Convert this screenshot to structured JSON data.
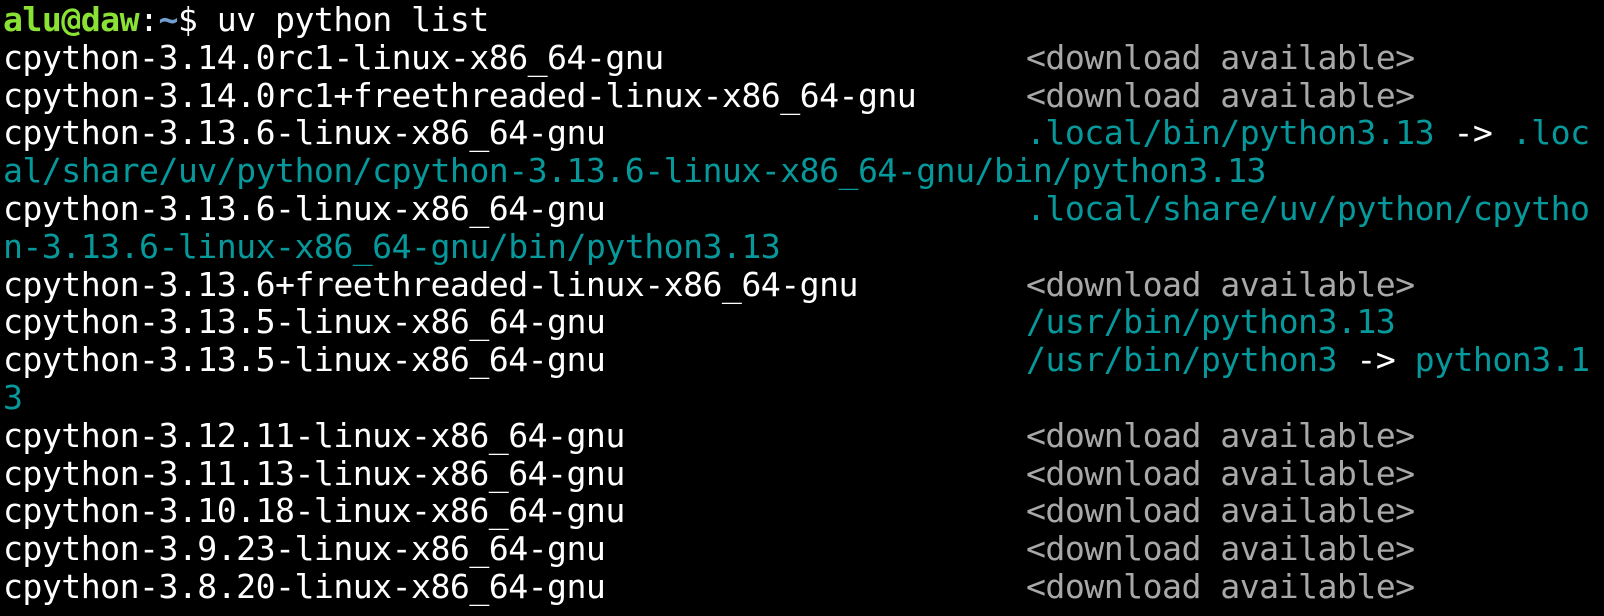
{
  "prompt": {
    "user_host": "alu@daw",
    "separator": ":",
    "path": "~",
    "dollar": "$ ",
    "command": "uv python list"
  },
  "colors": {
    "background": "#000000",
    "text": "#ffffff",
    "prompt_user": "#8ae234",
    "prompt_path": "#729fcf",
    "path_link": "#06989a",
    "download_available": "#a8a8a8"
  },
  "rows": [
    {
      "version": "cpython-3.14.0rc1-linux-x86_64-gnu",
      "status": "<download available>"
    },
    {
      "version": "cpython-3.14.0rc1+freethreaded-linux-x86_64-gnu",
      "status": "<download available>"
    },
    {
      "version": "cpython-3.13.6-linux-x86_64-gnu",
      "path": ".local/bin/python3.13",
      "arrow": " -> ",
      "target": ".loc",
      "wrap": "al/share/uv/python/cpython-3.13.6-linux-x86_64-gnu/bin/python3.13"
    },
    {
      "version": "cpython-3.13.6-linux-x86_64-gnu",
      "path": ".local/share/uv/python/cpytho",
      "wrap": "n-3.13.6-linux-x86_64-gnu/bin/python3.13"
    },
    {
      "version": "cpython-3.13.6+freethreaded-linux-x86_64-gnu",
      "status": "<download available>"
    },
    {
      "version": "cpython-3.13.5-linux-x86_64-gnu",
      "path": "/usr/bin/python3.13"
    },
    {
      "version": "cpython-3.13.5-linux-x86_64-gnu",
      "path": "/usr/bin/python3",
      "arrow": " -> ",
      "target": "python3.1",
      "wrap": "3"
    },
    {
      "version": "cpython-3.12.11-linux-x86_64-gnu",
      "status": "<download available>"
    },
    {
      "version": "cpython-3.11.13-linux-x86_64-gnu",
      "status": "<download available>"
    },
    {
      "version": "cpython-3.10.18-linux-x86_64-gnu",
      "status": "<download available>"
    },
    {
      "version": "cpython-3.9.23-linux-x86_64-gnu",
      "status": "<download available>"
    },
    {
      "version": "cpython-3.8.20-linux-x86_64-gnu",
      "status": "<download available>"
    }
  ]
}
